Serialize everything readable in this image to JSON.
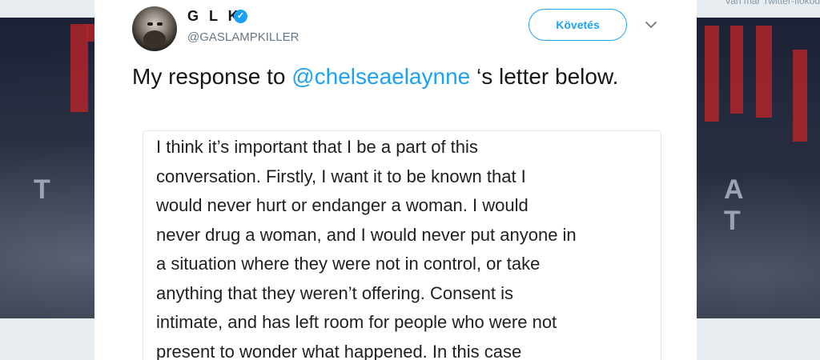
{
  "background": {
    "top_note": "van már Twitter-fiókod",
    "left_letter": "T",
    "right_letters": "A T"
  },
  "tweet": {
    "author_name": "G L K",
    "author_handle": "@GASLAMPKILLER",
    "follow_label": "Követés",
    "text_before": "My response to ",
    "mention": "@chelseaelaynne",
    "text_after": " ‘s letter below.",
    "attachment_lines": [
      "I think it’s important that I be a part of this",
      "conversation. Firstly, I want it to be known that I",
      "would never hurt or endanger a woman. I would",
      "never drug a woman, and I would never put anyone in",
      "a situation where they were not in control, or take",
      "anything that they weren’t offering. Consent is",
      "intimate, and has left room for people who were not",
      "present to wonder what happened. In this case"
    ]
  },
  "colors": {
    "link": "#1da1f2",
    "backdrop_red": "#b2252a"
  },
  "icons": {
    "verified": "verified-badge-icon",
    "menu": "chevron-down-icon"
  }
}
